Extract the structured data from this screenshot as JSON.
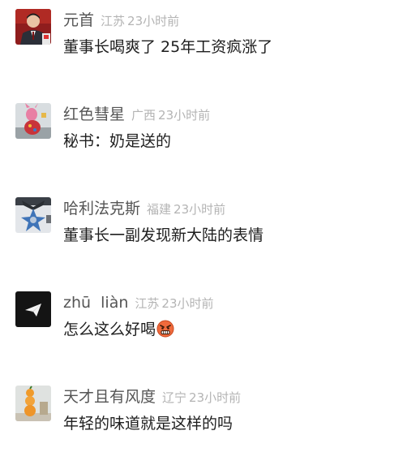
{
  "comments": [
    {
      "name": "元首",
      "location": "江苏",
      "time": "23小时前",
      "text": "董事长喝爽了 25年工资疯涨了",
      "avatar_icon": "man-in-suit-avatar-icon"
    },
    {
      "name": "红色彗星",
      "location": "广西",
      "time": "23小时前",
      "text": "秘书：奶是送的",
      "avatar_icon": "pink-figure-avatar-icon"
    },
    {
      "name": "哈利法克斯",
      "location": "福建",
      "time": "23小时前",
      "text": "董事长一副发现新大陆的表情",
      "avatar_icon": "blue-star-emblem-avatar-icon"
    },
    {
      "name": "zhū  liàn",
      "location": "江苏",
      "time": "23小时前",
      "text": "怎么这么好喝",
      "emoji": "angry-face-emoji",
      "avatar_icon": "paper-plane-avatar-icon"
    },
    {
      "name": "天才且有风度",
      "location": "辽宁",
      "time": "23小时前",
      "text": "年轻的味道就是这样的吗",
      "avatar_icon": "stacked-oranges-avatar-icon"
    }
  ],
  "colors": {
    "name": "#555555",
    "meta": "#b4b4b4",
    "text": "#1e1e1e",
    "background": "#ffffff"
  }
}
